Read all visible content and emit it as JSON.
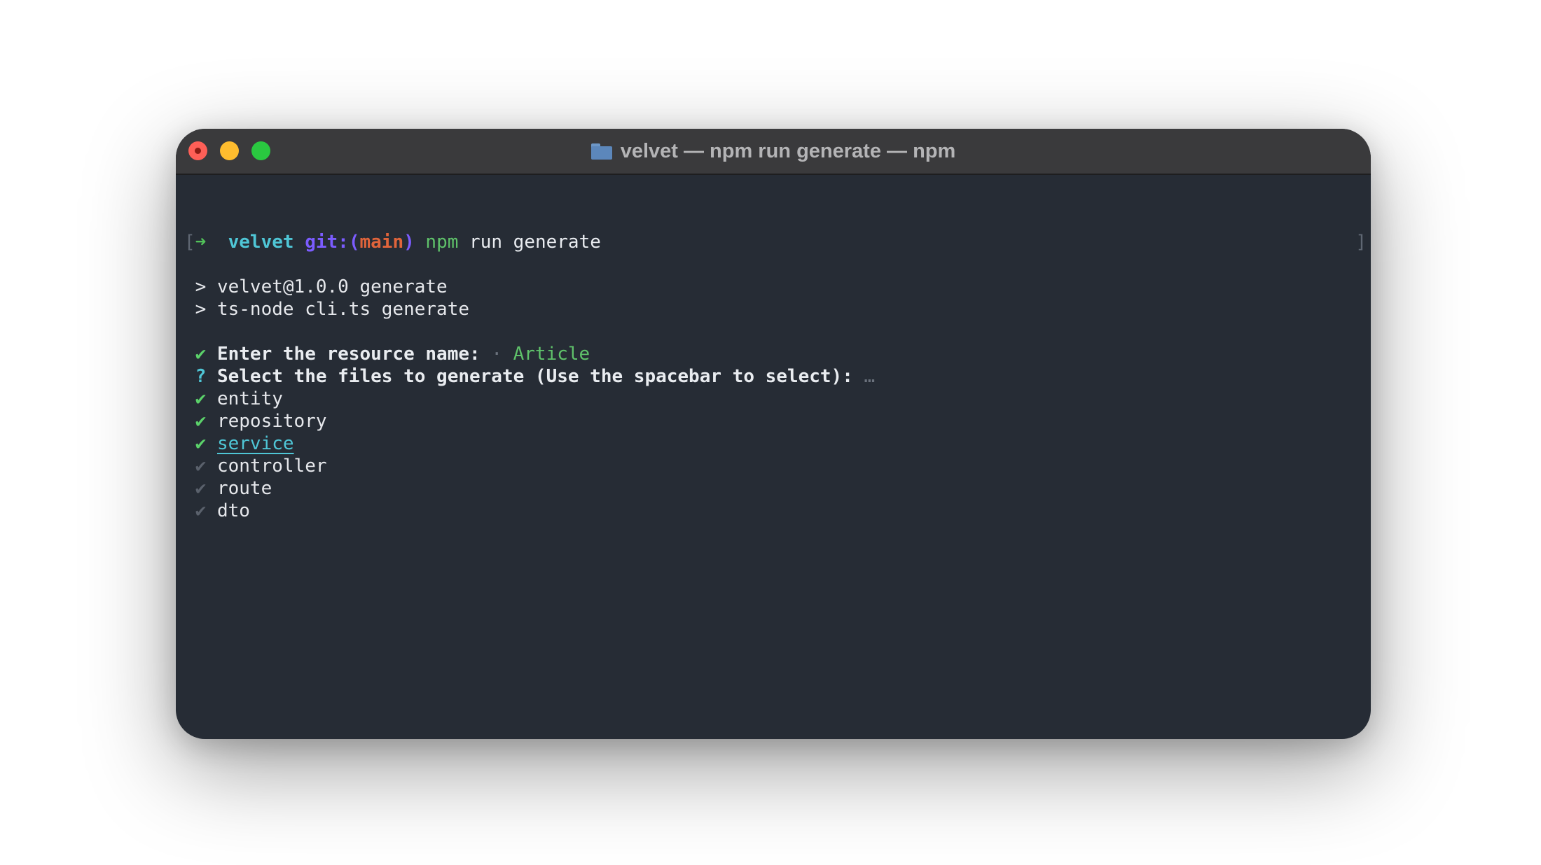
{
  "window": {
    "title": "velvet — npm run generate — npm"
  },
  "prompt": {
    "bracket_left": "[",
    "arrow": "➜",
    "dir": "velvet",
    "git_prefix": "git:(",
    "branch": "main",
    "git_suffix": ")",
    "cmd": "npm",
    "args": "run generate",
    "bracket_right": "]"
  },
  "output": {
    "marker": ">",
    "line1": "velvet@1.0.0 generate",
    "line2": "ts-node cli.ts generate"
  },
  "question1": {
    "check": "✔",
    "label": "Enter the resource name:",
    "sep": "·",
    "answer": "Article"
  },
  "question2": {
    "mark": "?",
    "label": "Select the files to generate (Use the spacebar to select):",
    "ellipsis": "…"
  },
  "options": [
    {
      "check": "✔",
      "label": "entity",
      "checked": true
    },
    {
      "check": "✔",
      "label": "repository",
      "checked": true
    },
    {
      "check": "✔",
      "label": "service",
      "checked": true,
      "focused": true
    },
    {
      "check": "✔",
      "label": "controller",
      "checked": false
    },
    {
      "check": "✔",
      "label": "route",
      "checked": false
    },
    {
      "check": "✔",
      "label": "dto",
      "checked": false
    }
  ]
}
